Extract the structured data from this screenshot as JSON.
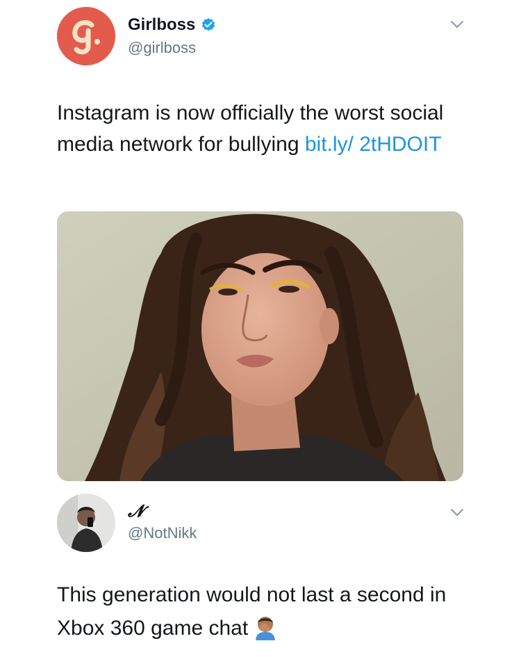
{
  "colors": {
    "link": "#1b95e0",
    "girlboss_avatar_bg": "#e35b4d",
    "verified_badge": "#1da1f2",
    "secondary_text": "#657786"
  },
  "tweet": {
    "author_name": "Girlboss",
    "verified": true,
    "avatar_icon": "girlboss-logo-icon",
    "handle": "@girlboss",
    "text_before_link": "Instagram is now officially the worst social media network for bullying ",
    "link_text": "bit.ly/ 2tHDOIT",
    "media_alt": "portrait-photo"
  },
  "reply": {
    "author_name": "𝓝",
    "handle": "@NotNikk",
    "avatar_icon": "profile-photo",
    "text": "This generation would not last a second in Xbox 360 game chat",
    "emoji_icon": "man-facepalming-emoji"
  }
}
